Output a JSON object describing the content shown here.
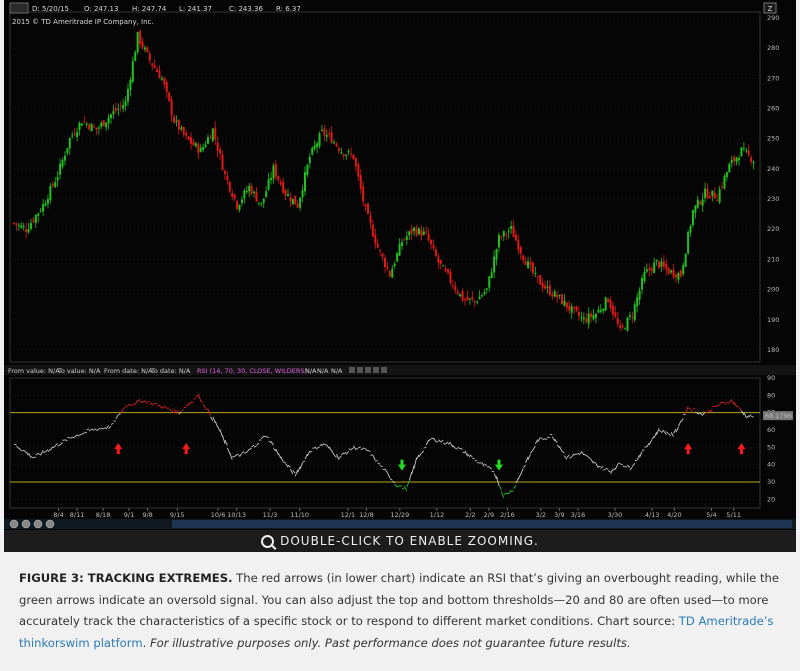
{
  "header": {
    "date": "D: 5/20/15",
    "open": "O: 247.13",
    "high": "H: 247.74",
    "low": "L: 241.37",
    "close": "C: 243.36",
    "range": "R: 6.37",
    "copyright": "2015 © TD Ameritrade IP Company, Inc."
  },
  "study_bar": {
    "from_value": "From value: N/A",
    "to_value": "To value: N/A",
    "from_date": "From date: N/A",
    "to_date": "To date: N/A",
    "rsi_label": "RSI (14, 70, 30, CLOSE, WILDERS)",
    "na1": "N/A",
    "na2": "N/A",
    "na3": "N/A"
  },
  "zoom_label": "DOUBLE-CLICK TO ENABLE ZOOMING.",
  "caption": {
    "title": "FIGURE 3: TRACKING EXTREMES.",
    "body": " The red arrows (in lower chart) indicate an RSI that’s giving an overbought reading, while the green arrows indicate an oversold signal. You can also adjust the top and bottom thresholds—20 and 80 are often used—to more accurately track the characteristics of a specific stock or to respond to different market conditions. Chart source: ",
    "link": "TD Ameritrade’s thinkorswim platform",
    "tail": ". ",
    "disclaimer": "For illustrative purposes only. Past performance does not guarantee future results."
  },
  "colors": {
    "up": "#1fc21f",
    "down": "#e01818",
    "rsi_line": "#c8c8c8",
    "threshold": "#b9a524",
    "overbought": "#e02020",
    "oversold": "#20c020"
  },
  "chart_data": [
    {
      "type": "candlestick",
      "title": "",
      "ylim": [
        176,
        292
      ],
      "yticks": [
        180,
        190,
        200,
        210,
        220,
        230,
        240,
        250,
        260,
        270,
        280,
        290
      ],
      "anchors": [
        [
          0,
          222
        ],
        [
          5,
          220
        ],
        [
          12,
          228
        ],
        [
          18,
          238
        ],
        [
          23,
          250
        ],
        [
          28,
          256
        ],
        [
          34,
          253
        ],
        [
          40,
          258
        ],
        [
          46,
          262
        ],
        [
          51,
          284
        ],
        [
          56,
          276
        ],
        [
          61,
          270
        ],
        [
          66,
          256
        ],
        [
          71,
          250
        ],
        [
          77,
          246
        ],
        [
          82,
          253
        ],
        [
          87,
          238
        ],
        [
          92,
          228
        ],
        [
          97,
          234
        ],
        [
          102,
          228
        ],
        [
          107,
          240
        ],
        [
          112,
          232
        ],
        [
          117,
          228
        ],
        [
          122,
          244
        ],
        [
          127,
          252
        ],
        [
          131,
          250
        ],
        [
          135,
          246
        ],
        [
          140,
          244
        ],
        [
          145,
          226
        ],
        [
          150,
          214
        ],
        [
          155,
          205
        ],
        [
          160,
          216
        ],
        [
          165,
          220
        ],
        [
          170,
          218
        ],
        [
          175,
          209
        ],
        [
          180,
          203
        ],
        [
          185,
          197
        ],
        [
          190,
          196
        ],
        [
          195,
          200
        ],
        [
          200,
          217
        ],
        [
          205,
          220
        ],
        [
          210,
          211
        ],
        [
          215,
          204
        ],
        [
          220,
          200
        ],
        [
          225,
          197
        ],
        [
          230,
          193
        ],
        [
          235,
          190
        ],
        [
          240,
          192
        ],
        [
          245,
          197
        ],
        [
          250,
          186
        ],
        [
          255,
          192
        ],
        [
          260,
          205
        ],
        [
          265,
          209
        ],
        [
          270,
          206
        ],
        [
          275,
          205
        ],
        [
          280,
          226
        ],
        [
          285,
          232
        ],
        [
          290,
          231
        ],
        [
          295,
          241
        ],
        [
          300,
          246
        ],
        [
          305,
          243
        ]
      ],
      "x_ticks": [
        "8/4",
        "8/11",
        "8/18",
        "9/1",
        "9/8",
        "9/15",
        "10/6",
        "10/13",
        "11/3",
        "11/10",
        "12/1",
        "12/8",
        "12/29",
        "1/12",
        "2/2",
        "2/9",
        "2/16",
        "3/2",
        "3/9",
        "3/16",
        "3/30",
        "4/13",
        "4/20",
        "5/4",
        "5/11"
      ],
      "x_tick_bars": [
        12,
        17,
        24,
        31,
        36,
        44,
        55,
        60,
        69,
        77,
        90,
        95,
        104,
        114,
        123,
        128,
        133,
        142,
        147,
        152,
        162,
        172,
        178,
        188,
        194
      ]
    },
    {
      "type": "line",
      "title": "RSI (14, 70, 30, CLOSE, WILDERS)",
      "ylim": [
        15,
        90
      ],
      "yticks": [
        20,
        30,
        40,
        50,
        60,
        70,
        80,
        90
      ],
      "overbought": 70,
      "oversold": 30,
      "last_value": "68.1796",
      "anchors": [
        [
          0,
          52
        ],
        [
          8,
          44
        ],
        [
          16,
          50
        ],
        [
          24,
          56
        ],
        [
          32,
          60
        ],
        [
          40,
          62
        ],
        [
          46,
          74
        ],
        [
          53,
          77
        ],
        [
          60,
          74
        ],
        [
          68,
          70
        ],
        [
          76,
          80
        ],
        [
          84,
          62
        ],
        [
          90,
          44
        ],
        [
          96,
          47
        ],
        [
          104,
          57
        ],
        [
          110,
          44
        ],
        [
          116,
          34
        ],
        [
          122,
          48
        ],
        [
          128,
          52
        ],
        [
          134,
          44
        ],
        [
          140,
          50
        ],
        [
          146,
          48
        ],
        [
          152,
          38
        ],
        [
          158,
          28
        ],
        [
          162,
          26
        ],
        [
          166,
          43
        ],
        [
          172,
          55
        ],
        [
          180,
          52
        ],
        [
          186,
          47
        ],
        [
          192,
          41
        ],
        [
          198,
          36
        ],
        [
          202,
          22
        ],
        [
          206,
          26
        ],
        [
          210,
          38
        ],
        [
          216,
          54
        ],
        [
          222,
          57
        ],
        [
          228,
          44
        ],
        [
          234,
          47
        ],
        [
          240,
          40
        ],
        [
          246,
          36
        ],
        [
          250,
          41
        ],
        [
          254,
          38
        ],
        [
          260,
          49
        ],
        [
          266,
          60
        ],
        [
          272,
          57
        ],
        [
          278,
          73
        ],
        [
          284,
          69
        ],
        [
          290,
          74
        ],
        [
          296,
          77
        ],
        [
          302,
          68
        ]
      ],
      "up_arrows": [
        43,
        71,
        278,
        300
      ],
      "down_arrows": [
        160,
        200
      ]
    }
  ]
}
